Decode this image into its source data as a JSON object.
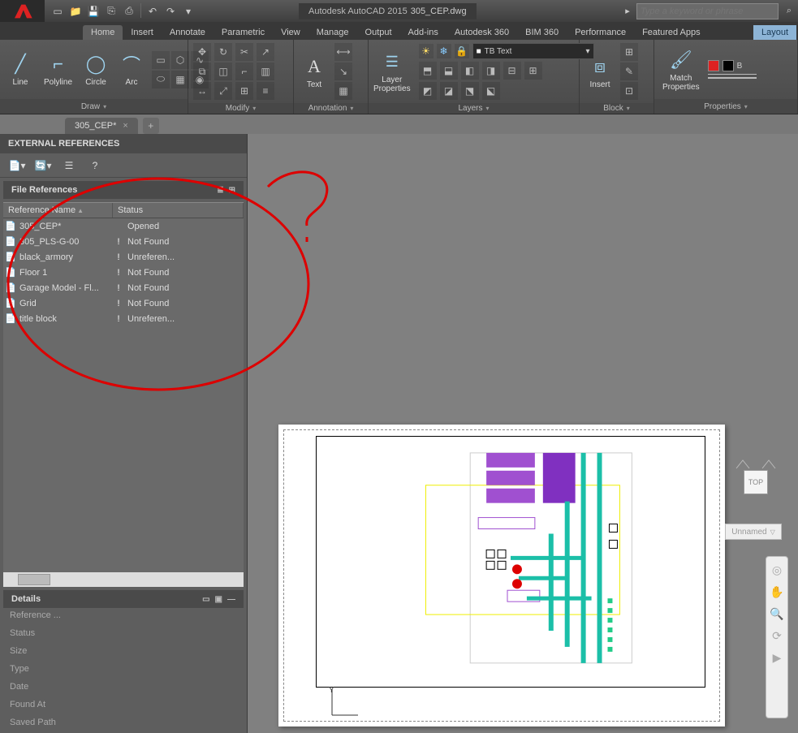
{
  "titlebar": {
    "app": "Autodesk AutoCAD 2015",
    "file": "305_CEP.dwg",
    "search_placeholder": "Type a keyword or phrase"
  },
  "ribbon_tabs": [
    "Home",
    "Insert",
    "Annotate",
    "Parametric",
    "View",
    "Manage",
    "Output",
    "Add-ins",
    "Autodesk 360",
    "BIM 360",
    "Performance",
    "Featured Apps",
    "Layout"
  ],
  "draw": {
    "line": "Line",
    "polyline": "Polyline",
    "circle": "Circle",
    "arc": "Arc",
    "title": "Draw"
  },
  "modify": {
    "title": "Modify"
  },
  "annotation": {
    "text": "Text",
    "title": "Annotation"
  },
  "layers": {
    "layer_props": "Layer\nProperties",
    "combo": "TB Text",
    "title": "Layers"
  },
  "block": {
    "insert": "Insert",
    "title": "Block"
  },
  "properties": {
    "match": "Match\nProperties",
    "title": "Properties"
  },
  "doc_tab": "305_CEP*",
  "palette": {
    "title": "EXTERNAL REFERENCES",
    "section": "File References",
    "col_name": "Reference Name",
    "col_status": "Status",
    "rows": [
      {
        "name": "305_CEP*",
        "status": "Opened",
        "warn": ""
      },
      {
        "name": "305_PLS-G-00",
        "status": "Not Found",
        "warn": "!"
      },
      {
        "name": "black_armory",
        "status": "Unreferen...",
        "warn": "!"
      },
      {
        "name": "Floor 1",
        "status": "Not Found",
        "warn": "!"
      },
      {
        "name": "Garage Model - Fl...",
        "status": "Not Found",
        "warn": "!"
      },
      {
        "name": "Grid",
        "status": "Not Found",
        "warn": "!"
      },
      {
        "name": "title block",
        "status": "Unreferen...",
        "warn": "!"
      }
    ],
    "details_title": "Details",
    "detail_fields": [
      "Reference ...",
      "Status",
      "Size",
      "Type",
      "Date",
      "Found At",
      "Saved Path"
    ]
  },
  "navcube": {
    "face": "TOP",
    "view": "Unnamed"
  }
}
